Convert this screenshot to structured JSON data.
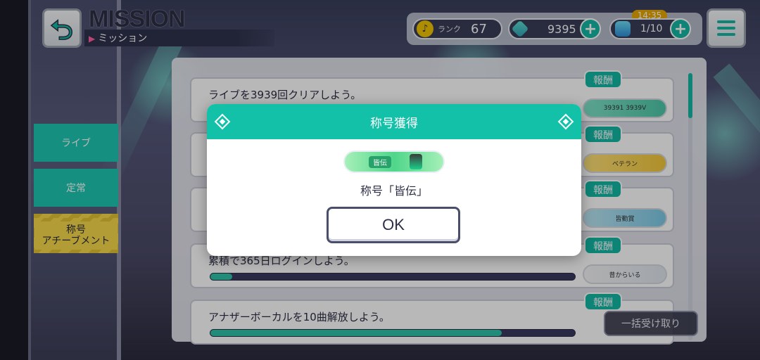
{
  "header": {
    "title": "MISSION",
    "subtitle": "ミッション",
    "rank_label": "ランク",
    "rank_value": "67",
    "gems": "9395",
    "stamina": "1/10",
    "timer": "14:35"
  },
  "sidebar": {
    "items": [
      {
        "label": "ライブ"
      },
      {
        "label": "定常"
      },
      {
        "label": "称号\nアチーブメント"
      }
    ]
  },
  "missions": [
    {
      "text": "ライブを3939回クリアしよう。",
      "reward_label": "報酬",
      "reward_plate": "39391  3939V",
      "progress": null
    },
    {
      "text": "",
      "reward_label": "報酬",
      "reward_plate": "ベテラン",
      "progress": null
    },
    {
      "text": "",
      "reward_label": "報酬",
      "reward_plate": "皆勤賞",
      "progress": null
    },
    {
      "text": "累積で365日ログインしよう。",
      "reward_label": "報酬",
      "reward_plate": "昔からいる",
      "progress": 0.06
    },
    {
      "text": "アナザーボーカルを10曲解放しよう。",
      "reward_label": "報酬",
      "reward_plate": "",
      "progress": 0.8
    }
  ],
  "claim_all_label": "一括受け取り",
  "dialog": {
    "title": "称号獲得",
    "plate_text": "皆伝",
    "message": "称号「皆伝」",
    "ok_label": "OK"
  },
  "colors": {
    "accent": "#12c1a8",
    "dark": "#2b2e45",
    "highlight_tab": "#f5d84a"
  }
}
